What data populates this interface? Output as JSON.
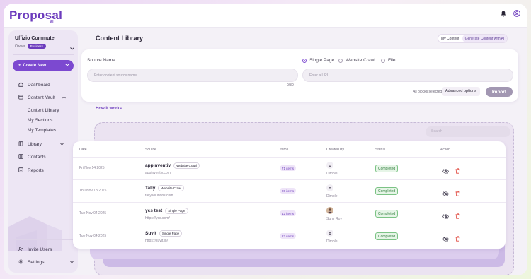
{
  "app": {
    "logo": "Proposal",
    "logo_sub": "ai"
  },
  "org": {
    "name": "Uffizio Commute",
    "role": "Owner",
    "plan": "Business"
  },
  "sidebar": {
    "create_label": "Create New",
    "items": [
      {
        "label": "Dashboard",
        "icon": "home-icon"
      },
      {
        "label": "Content Vault",
        "icon": "vault-icon"
      },
      {
        "label": "Content Library"
      },
      {
        "label": "My Sections"
      },
      {
        "label": "My Templates"
      },
      {
        "label": "Library",
        "icon": "book-icon"
      },
      {
        "label": "Contacts",
        "icon": "contacts-icon"
      },
      {
        "label": "Reports",
        "icon": "chart-icon"
      }
    ],
    "invite_label": "Invite Users",
    "settings_label": "Settings"
  },
  "page": {
    "title": "Content Library",
    "toggle": [
      "My Content",
      "Generate Content with AI"
    ]
  },
  "import_form": {
    "source_name_label": "Source Name",
    "source_name_placeholder": "Enter content source name",
    "counter": "0/30",
    "types": [
      "Single Page",
      "Website Crawl",
      "File"
    ],
    "url_placeholder": "Enter a URL",
    "blocks_text": "All blocks selected",
    "advanced_label": "Advanced options",
    "import_label": "Import"
  },
  "how_it_works": "How it works",
  "search_placeholder": "Search",
  "table": {
    "headers": [
      "Date",
      "Source",
      "Items",
      "Created By",
      "Status",
      "Action"
    ],
    "rows": [
      {
        "date": "Fri Nov 14 2025",
        "name": "appinventiv",
        "type": "Website Crawl",
        "url": "appinventiv.com",
        "items": "71 items",
        "initial": "D",
        "creator": "Dimple",
        "status": "Completed"
      },
      {
        "date": "Thu Nov 13 2025",
        "name": "Tally",
        "type": "Website Crawl",
        "url": "tallysolutions.com",
        "items": "20 items",
        "initial": "D",
        "creator": "Dimple",
        "status": "Completed"
      },
      {
        "date": "Tue Nov 04 2025",
        "name": "ycs test",
        "type": "Single Page",
        "url": "https://ycs.com/",
        "items": "12 items",
        "initial": "",
        "creator": "Sunir Roy",
        "status": "Completed"
      },
      {
        "date": "Tue Nov 04 2025",
        "name": "Suvit",
        "type": "Single Page",
        "url": "https://suvit.io/",
        "items": "22 items",
        "initial": "D",
        "creator": "Dimple",
        "status": "Completed"
      }
    ]
  },
  "colors": {
    "accent": "#7c49d0",
    "status_green": "#2f7d3b",
    "delete_red": "#e0443a"
  }
}
